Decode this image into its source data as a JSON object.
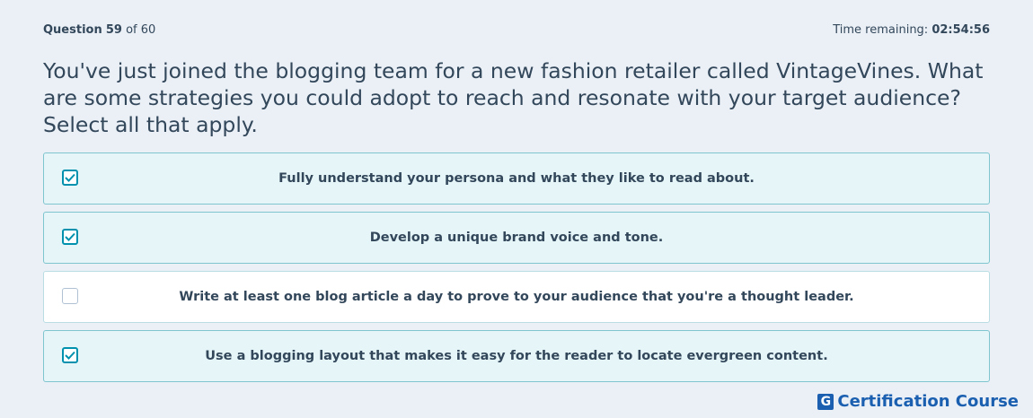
{
  "header": {
    "question_label": "Question",
    "question_number": "59",
    "question_of": "of 60",
    "time_label": "Time remaining:",
    "time_value": "02:54:56"
  },
  "question": {
    "text": "You've just joined the blogging team for a new fashion retailer called VintageVines. What are some strategies you could adopt to reach and resonate with your target audience? Select all that apply."
  },
  "options": [
    {
      "label": "Fully understand your persona and what they like to read about.",
      "checked": true
    },
    {
      "label": "Develop a unique brand voice and tone.",
      "checked": true
    },
    {
      "label": "Write at least one blog article a day to prove to your audience that you're a thought leader.",
      "checked": false
    },
    {
      "label": "Use a blogging layout that makes it easy for the reader to locate evergreen content.",
      "checked": true
    }
  ],
  "brand": {
    "mark": "G",
    "text": "Certification Course"
  },
  "colors": {
    "accent": "#0091ae",
    "selected_bg": "#e5f5f8",
    "brand": "#1b5fb0",
    "text": "#33475b"
  }
}
